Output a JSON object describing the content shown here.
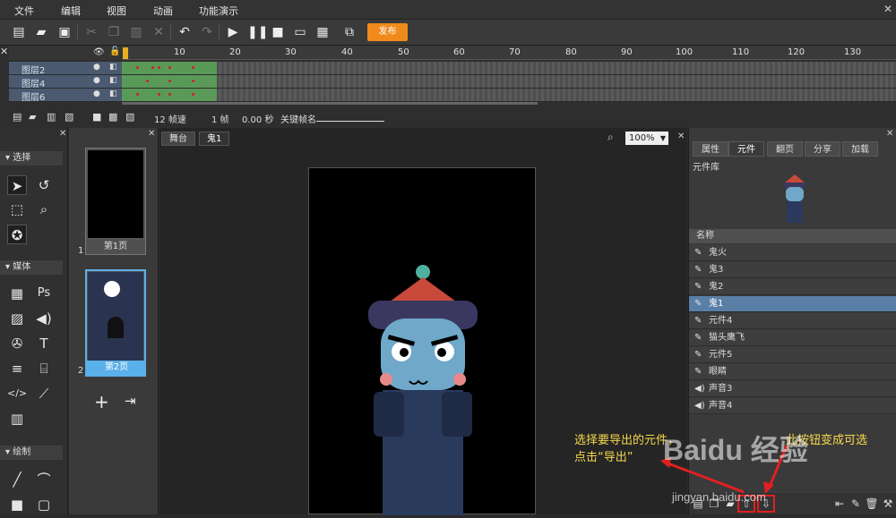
{
  "menu": [
    "文件",
    "编辑",
    "视图",
    "动画",
    "功能演示"
  ],
  "toolbar": {
    "publish_label": "发布"
  },
  "ruler": {
    "ticks": [
      "10",
      "20",
      "30",
      "40",
      "50",
      "60",
      "70",
      "80",
      "90",
      "100",
      "110",
      "120",
      "130"
    ]
  },
  "layers": [
    {
      "name": "图层2",
      "selected": true
    },
    {
      "name": "图层4",
      "selected": false
    },
    {
      "name": "图层6",
      "selected": false
    }
  ],
  "timeline_footer": {
    "fps": "12 帧速",
    "frame": "1 帧",
    "time": "0.00 秒",
    "keyframe_label": "关键帧名"
  },
  "tools": {
    "select_section": "选择",
    "media_section": "媒体",
    "draw_section": "绘制"
  },
  "pages": [
    {
      "num": "1",
      "label": "第1页"
    },
    {
      "num": "2",
      "label": "第2页"
    }
  ],
  "stage": {
    "tabs": [
      "舞台",
      "鬼1"
    ],
    "zoom": "100%"
  },
  "right_panel": {
    "tabs": [
      "属性",
      "元件",
      "翻页",
      "分享",
      "加载"
    ],
    "library_title": "元件库",
    "list_header": "名称",
    "items": [
      {
        "name": "鬼火",
        "type": "symbol",
        "selected": false
      },
      {
        "name": "鬼3",
        "type": "symbol",
        "selected": false
      },
      {
        "name": "鬼2",
        "type": "symbol",
        "selected": false
      },
      {
        "name": "鬼1",
        "type": "symbol",
        "selected": true
      },
      {
        "name": "元件4",
        "type": "symbol",
        "selected": false
      },
      {
        "name": "猫头鹰飞",
        "type": "symbol",
        "selected": false
      },
      {
        "name": "元件5",
        "type": "symbol",
        "selected": false
      },
      {
        "name": "眼睛",
        "type": "symbol",
        "selected": false
      },
      {
        "name": "声音3",
        "type": "sound",
        "selected": false
      },
      {
        "name": "声音4",
        "type": "sound",
        "selected": false
      }
    ]
  },
  "annotations": {
    "left_line1": "选择要导出的元件，",
    "left_line2": "点击“导出”",
    "right_line1": "此按钮变成可选"
  },
  "watermark": {
    "main": "Baidu 经验",
    "sub": "jingyan.baidu.com"
  },
  "colors": {
    "accent": "#f08a1c",
    "selection": "#5a7fa6",
    "annotation": "#f7d84a",
    "highlight": "#e02020"
  }
}
